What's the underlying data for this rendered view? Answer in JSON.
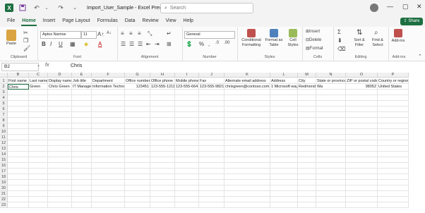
{
  "titlebar": {
    "title": "Import_User_Sample  -  Excel Preview",
    "search_placeholder": "Search",
    "minimize": "—",
    "maximize": "▢",
    "close": "✕",
    "logo": "X"
  },
  "menu": {
    "tabs": [
      "File",
      "Home",
      "Insert",
      "Page Layout",
      "Formulas",
      "Data",
      "Review",
      "View",
      "Help"
    ],
    "active": "Home",
    "share_label": "Share"
  },
  "ribbon": {
    "font_name": "Aptos Narrow",
    "font_size": "11",
    "number_format": "General",
    "groups": {
      "clipboard": "Clipboard",
      "font": "Font",
      "alignment": "Alignment",
      "number": "Number",
      "styles": "Styles",
      "cells": "Cells",
      "editing": "Editing",
      "addins": "Add-ins"
    },
    "paste": "Paste",
    "conditional": "Conditional\nFormatting",
    "format_table": "Format as\nTable",
    "cell_styles": "Cell\nStyles",
    "insert": "Insert",
    "delete": "Delete",
    "format": "Format",
    "sort_filter": "Sort &\nFilter",
    "find_select": "Find &\nSelect",
    "addins_btn": "Add-ins"
  },
  "formula_bar": {
    "name_box": "B2",
    "fx": "fx",
    "value": "Chris"
  },
  "sheet": {
    "columns": [
      "B",
      "C",
      "D",
      "E",
      "F",
      "G",
      "H",
      "I",
      "J",
      "K",
      "L",
      "M",
      "N",
      "O",
      "P"
    ],
    "rows": [
      "1",
      "2",
      "3",
      "4",
      "5",
      "6",
      "7",
      "8",
      "9",
      "10",
      "11",
      "12",
      "13",
      "14",
      "15",
      "16",
      "17",
      "18",
      "19",
      "20",
      "21",
      "22",
      "23"
    ],
    "headers": [
      "First name",
      "Last name",
      "Display name",
      "Job title",
      "Department",
      "Office number",
      "Office phone",
      "Mobile phone",
      "Fax",
      "Alternate email address",
      "Address",
      "City",
      "State or province",
      "ZIP or postal code",
      "Country or region"
    ],
    "row2": [
      "Chris",
      "Green",
      "Chris Green",
      "IT Manager",
      "Information Technology",
      "123451",
      "123-555-1211",
      "123-555-6641",
      "123-555-9821",
      "chrisgreen@contoso.com",
      "1 Microsoft way",
      "Redmond",
      "Wa",
      "98052",
      "United States"
    ]
  }
}
